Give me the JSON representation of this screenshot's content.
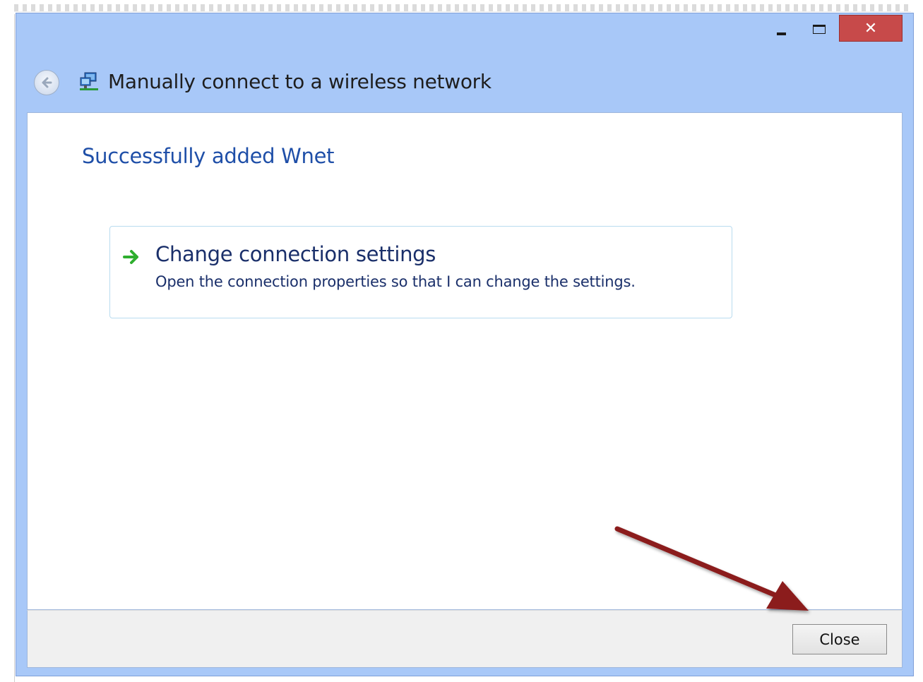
{
  "window": {
    "title": "Manually connect to a wireless network",
    "close_glyph": "✕"
  },
  "icons": {
    "back": "back-arrow-icon",
    "network": "network-icon",
    "command_link": "green-arrow-icon"
  },
  "content": {
    "headline": "Successfully added Wnet",
    "command_link": {
      "title": "Change connection settings",
      "description": "Open the connection properties so that I can change the settings."
    }
  },
  "footer": {
    "close_label": "Close"
  },
  "colors": {
    "frame": "#a8c8f8",
    "close_button": "#c74a4a",
    "headline": "#1f4fa8",
    "annotation_arrow": "#8b1a1a",
    "command_arrow": "#2eae2e"
  }
}
